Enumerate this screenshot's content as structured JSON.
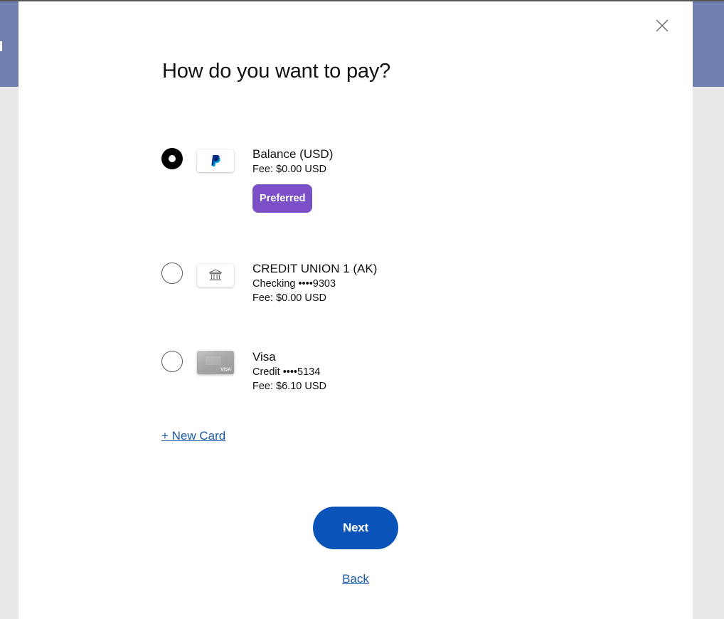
{
  "dialog": {
    "title": "How do you want to pay?"
  },
  "payment_options": [
    {
      "name": "Balance (USD)",
      "lines": [
        "Fee: $0.00 USD"
      ],
      "badge": "Preferred",
      "selected": true,
      "icon": "paypal-logo-icon"
    },
    {
      "name": "CREDIT UNION 1 (AK)",
      "lines": [
        "Checking ••••9303",
        "Fee: $0.00 USD"
      ],
      "selected": false,
      "icon": "bank-icon"
    },
    {
      "name": "Visa",
      "lines": [
        "Credit ••••5134",
        "Fee: $6.10 USD"
      ],
      "selected": false,
      "icon": "visa-card-icon",
      "card_brand": "VISA"
    }
  ],
  "actions": {
    "new_card": "+ New Card",
    "next": "Next",
    "back": "Back"
  },
  "colors": {
    "header_band": "#7280b0",
    "page_background": "#e8e8e8",
    "badge": "#7b4fc6",
    "primary_button": "#0a53b8",
    "link": "#1a5aa8",
    "paypal_dark": "#003087",
    "paypal_light": "#009cde"
  }
}
